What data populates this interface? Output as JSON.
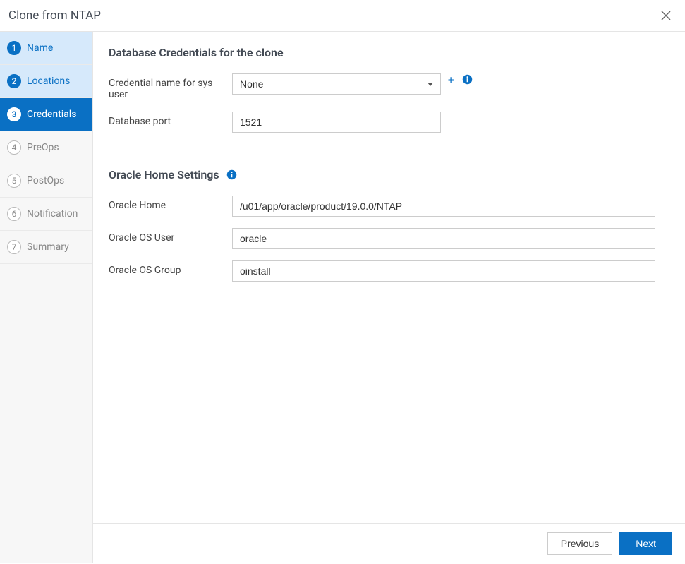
{
  "header": {
    "title": "Clone from NTAP"
  },
  "sidebar": {
    "steps": [
      {
        "num": "1",
        "label": "Name",
        "state": "completed"
      },
      {
        "num": "2",
        "label": "Locations",
        "state": "completed"
      },
      {
        "num": "3",
        "label": "Credentials",
        "state": "active"
      },
      {
        "num": "4",
        "label": "PreOps",
        "state": "pending"
      },
      {
        "num": "5",
        "label": "PostOps",
        "state": "pending"
      },
      {
        "num": "6",
        "label": "Notification",
        "state": "pending"
      },
      {
        "num": "7",
        "label": "Summary",
        "state": "pending"
      }
    ]
  },
  "main": {
    "section1_title": "Database Credentials for the clone",
    "cred_label": "Credential name for sys user",
    "cred_value": "None",
    "port_label": "Database port",
    "port_value": "1521",
    "section2_title": "Oracle Home Settings",
    "home_label": "Oracle Home",
    "home_value": "/u01/app/oracle/product/19.0.0/NTAP",
    "osuser_label": "Oracle OS User",
    "osuser_value": "oracle",
    "osgroup_label": "Oracle OS Group",
    "osgroup_value": "oinstall"
  },
  "footer": {
    "previous": "Previous",
    "next": "Next"
  }
}
